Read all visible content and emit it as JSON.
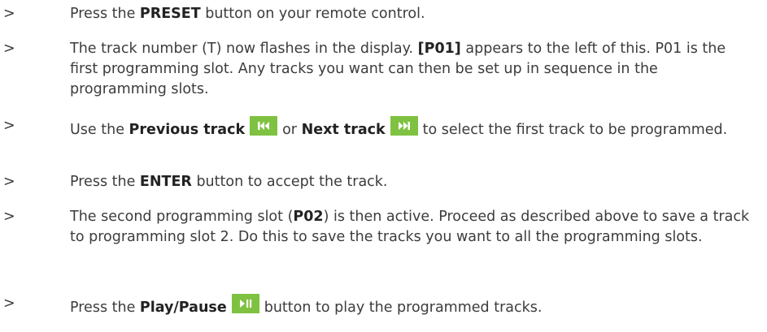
{
  "colors": {
    "text": "#3c3c3c",
    "bold_text": "#222222",
    "button_bg": "#7fc242",
    "button_glyph": "#ffffff"
  },
  "marker": ">",
  "steps": [
    {
      "a": "Press the ",
      "b1": "PRESET",
      "c": " button on your remote control."
    },
    {
      "a": "The track number (T) now flashes in the display. ",
      "b1": "[P01]",
      "c": " appears to the left of this. P01 is the first programming slot. Any tracks you want can then be set up in sequence in the programming slots."
    },
    {
      "a": "Use the ",
      "b1": "Previous track",
      "icon1": "previous-track-icon",
      "mid": "or ",
      "b2": "Next track",
      "icon2": "next-track-icon",
      "c": "to select the first track to be programmed."
    },
    {
      "a": "Press the ",
      "b1": "ENTER",
      "c": " button to accept the track."
    },
    {
      "a": "The second programming slot (",
      "b1": "P02",
      "c": ") is then active. Proceed as described above to save a track to programming slot 2. Do this to save the tracks you want to all the programming slots."
    },
    {
      "a": "Press the ",
      "b1": "Play/Pause",
      "icon1": "play-pause-icon",
      "c": "button to play the programmed tracks."
    }
  ]
}
